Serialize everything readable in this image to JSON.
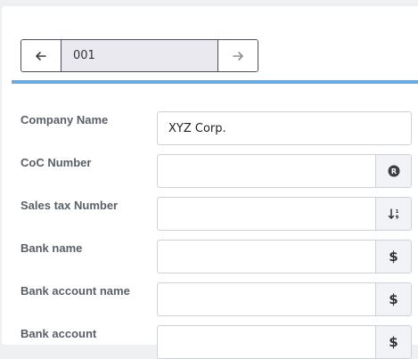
{
  "pager": {
    "prev_icon": "arrow-left-icon",
    "value": "001",
    "next_icon": "arrow-right-icon"
  },
  "colors": {
    "accent": "#6aa9e1",
    "pager_value_bg": "#e9e9ef",
    "addon_bg": "#f2f3f6"
  },
  "fields": [
    {
      "label": "Company Name",
      "value": "XYZ Corp.",
      "addon_icon": null
    },
    {
      "label": "CoC Number",
      "value": "",
      "addon_icon": "registered-icon"
    },
    {
      "label": "Sales tax Number",
      "value": "",
      "addon_icon": "sort-numeric-down-icon"
    },
    {
      "label": "Bank name",
      "value": "",
      "addon_icon": "dollar-icon",
      "addon_text": "$"
    },
    {
      "label": "Bank account name",
      "value": "",
      "addon_icon": "dollar-icon",
      "addon_text": "$"
    },
    {
      "label": "Bank account",
      "value": "",
      "addon_icon": "dollar-icon",
      "addon_text": "$"
    }
  ]
}
